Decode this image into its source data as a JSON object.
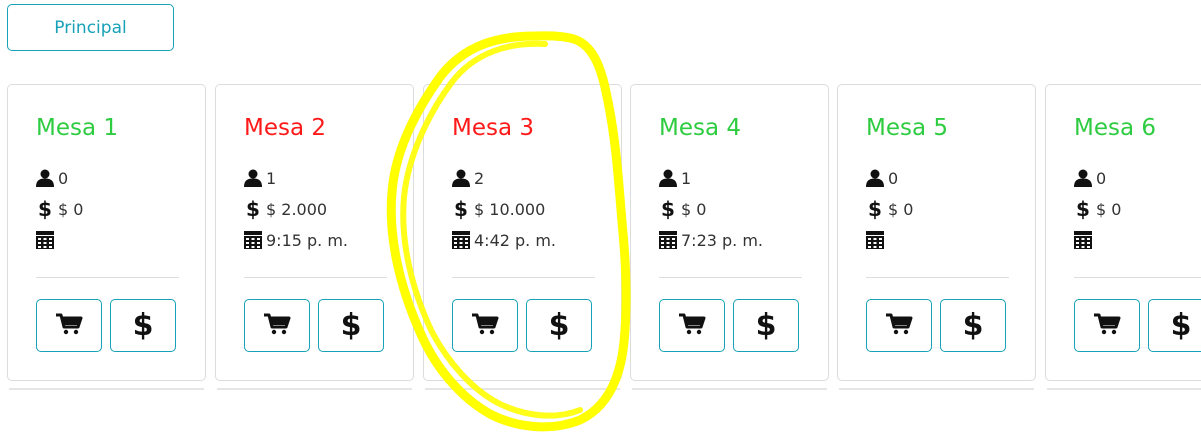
{
  "top_button": {
    "label": "Principal"
  },
  "colors": {
    "accent": "#17a2b8",
    "free": "#2ecc40",
    "busy": "#ff1a1a",
    "highlight": "#ffff00"
  },
  "icons": {
    "persons": "person-icon",
    "amount": "dollar-icon",
    "time": "calendar-icon",
    "cart": "cart-icon",
    "pay": "dollar-icon"
  },
  "tables": [
    {
      "title": "Mesa 1",
      "status": "free",
      "persons": "0",
      "amount": "$ 0",
      "time": ""
    },
    {
      "title": "Mesa 2",
      "status": "busy",
      "persons": "1",
      "amount": "$ 2.000",
      "time": "9:15 p. m."
    },
    {
      "title": "Mesa 3",
      "status": "busy",
      "persons": "2",
      "amount": "$ 10.000",
      "time": "4:42 p. m."
    },
    {
      "title": "Mesa 4",
      "status": "free",
      "persons": "1",
      "amount": "$ 0",
      "time": "7:23 p. m."
    },
    {
      "title": "Mesa 5",
      "status": "free",
      "persons": "0",
      "amount": "$ 0",
      "time": ""
    },
    {
      "title": "Mesa 6",
      "status": "free",
      "persons": "0",
      "amount": "$ 0",
      "time": ""
    }
  ],
  "buttons": {
    "pay_symbol": "$"
  },
  "dollar_symbol": "$"
}
